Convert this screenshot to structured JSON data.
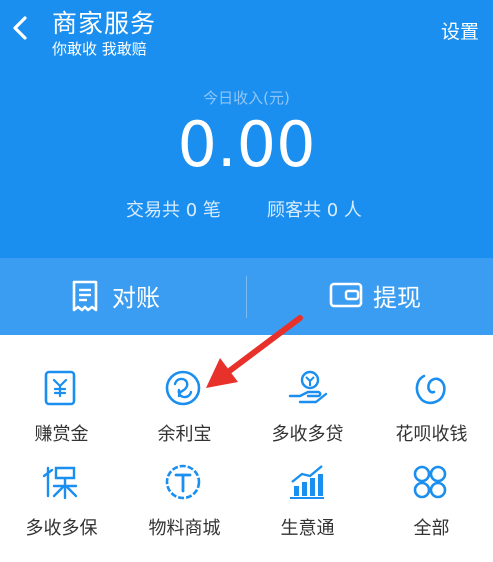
{
  "header": {
    "title": "商家服务",
    "subtitle": "你敢收 我敢赔",
    "settings_label": "设置"
  },
  "income": {
    "label": "今日收入(元)",
    "amount": "0.00",
    "trades_text": "交易共 0 笔",
    "customers_text": "顾客共 0 人"
  },
  "actions": [
    {
      "label": "对账",
      "icon": "receipt-icon"
    },
    {
      "label": "提现",
      "icon": "wallet-icon"
    }
  ],
  "services": [
    {
      "label": "赚赏金",
      "icon": "reward-envelope-icon"
    },
    {
      "label": "余利宝",
      "icon": "yulibao-icon"
    },
    {
      "label": "多收多贷",
      "icon": "loan-hand-icon"
    },
    {
      "label": "花呗收钱",
      "icon": "huabei-icon"
    },
    {
      "label": "多收多保",
      "icon": "insurance-icon"
    },
    {
      "label": "物料商城",
      "icon": "material-shop-icon"
    },
    {
      "label": "生意通",
      "icon": "business-chart-icon"
    },
    {
      "label": "全部",
      "icon": "all-grid-icon"
    }
  ],
  "colors": {
    "brand_blue": "#1b8ff0",
    "annotation_red": "#e8312a"
  }
}
